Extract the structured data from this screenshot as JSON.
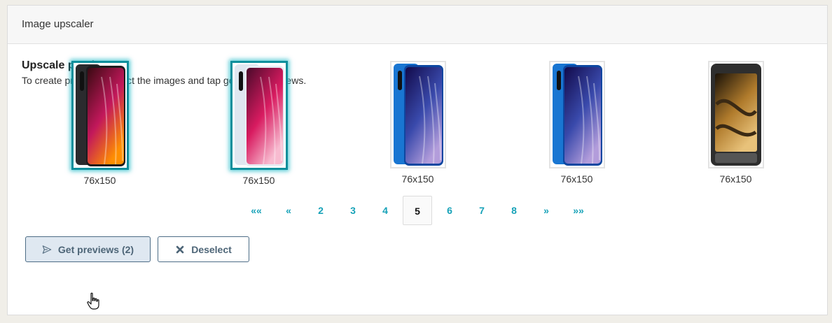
{
  "header": {
    "title": "Image upscaler"
  },
  "section": {
    "title": "Upscale previews",
    "description": "To create previews, select the images and tap generate previews."
  },
  "images": [
    {
      "dims": "76x150",
      "selected": true,
      "variant": "dark-orange"
    },
    {
      "dims": "76x150",
      "selected": true,
      "variant": "white-pink"
    },
    {
      "dims": "76x150",
      "selected": false,
      "variant": "blue-purple"
    },
    {
      "dims": "76x150",
      "selected": false,
      "variant": "blue-purple"
    },
    {
      "dims": "76x150",
      "selected": false,
      "variant": "rugged-gold"
    }
  ],
  "pagination": {
    "items": [
      "««",
      "«",
      "2",
      "3",
      "4",
      "5",
      "6",
      "7",
      "8",
      "»",
      "»»"
    ],
    "active": "5"
  },
  "actions": {
    "get_previews": "Get previews (2)",
    "deselect": "Deselect"
  },
  "colors": {
    "accent": "#17a2b8",
    "selection": "#0f8f9c",
    "button_border": "#4d6d86"
  }
}
